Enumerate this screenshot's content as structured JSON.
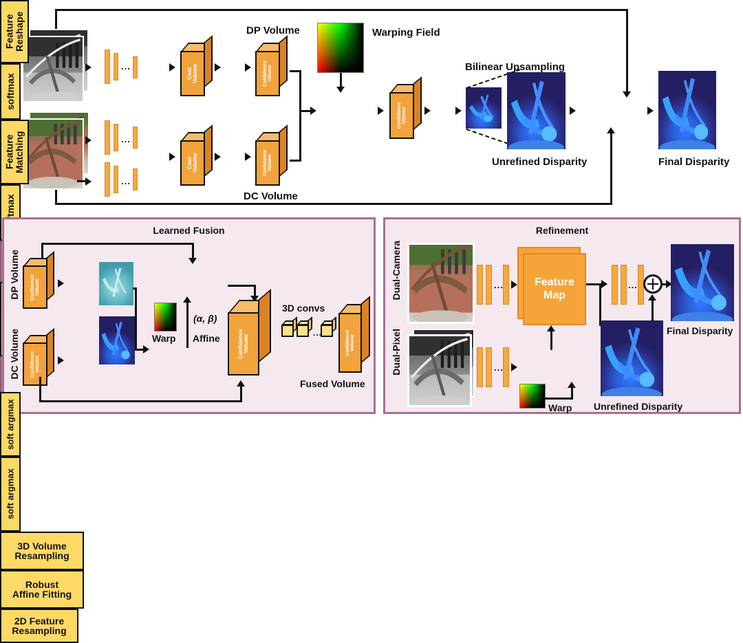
{
  "figure": {
    "title": "Dual-Pixel / Dual-Camera disparity fusion network architecture",
    "colors": {
      "volume_face": "#f2a33c",
      "volume_top": "#f7bc6a",
      "volume_side": "#d98324",
      "yellow_box": "#ffd966",
      "mauve_box": "#bd7fa0",
      "panel_bg": "#f5e8ef",
      "panel_border": "#a9708f",
      "conv_bar": "#f6a93b",
      "stroke": "#111111"
    }
  },
  "top": {
    "input_dual_pixel_label": "Dual-Pixel",
    "input_dual_camera_label": "Dual-Camera",
    "dp_branch": {
      "dots": "...",
      "op_box": "Feature\nReshape",
      "cost_volume": "Cost\nVolume",
      "softmax": "softmax",
      "confidence_volume": "Confidence\nVolume",
      "output_label": "DP Volume"
    },
    "dc_branch": {
      "dots": "...",
      "op_box": "Feature\nMatching",
      "cost_volume": "Cost\nVolume",
      "softmax": "softmax",
      "confidence_volume": "Confidence\nVolume",
      "output_label": "DC Volume"
    },
    "warping_field_label": "Warping Field",
    "learned_fusion": "Learned\nFusion",
    "fused_confidence_volume": "Confidence\nVolume",
    "soft_argmax": "soft argmax",
    "bilinear_upsampling": "Bilinear Upsampling",
    "unrefined_disparity": "Unrefined Disparity",
    "refinement": "Refinement",
    "final_disparity": "Final Disparity"
  },
  "fusion_panel": {
    "title": "Learned Fusion",
    "dp_volume_label": "DP Volume",
    "dc_volume_label": "DC Volume",
    "dp_confidence_volume": "Confidence\nVolume",
    "dc_confidence_volume": "Confidence\nVolume",
    "soft_argmax_top": "soft argmax",
    "soft_argmax_bottom": "soft argmax",
    "resampling_box": "3D Volume\nResampling",
    "affine_box": "Robust\nAffine Fitting",
    "warp_label": "Warp",
    "affine_params_label": "(α, β)",
    "affine_sub_label": "Affine",
    "mid_confidence_volume": "Confidence\nVolume",
    "conv_label": "3D convs",
    "conv_dots": "...",
    "fused_confidence_volume": "Confidence\nVolume",
    "fused_caption": "Fused Volume"
  },
  "refinement_panel": {
    "title": "Refinement",
    "dual_camera_label": "Dual-Camera",
    "dual_pixel_label": "Dual-Pixel",
    "dots_top": "...",
    "dots_bottom": "...",
    "dots_right": "...",
    "feature_map": "Feature\nMap",
    "resampling_box": "2D Feature\nResampling",
    "warp_label": "Warp",
    "unrefined_disparity": "Unrefined Disparity",
    "final_disparity": "Final Disparity",
    "sum_icon": "plus-circle-icon"
  }
}
